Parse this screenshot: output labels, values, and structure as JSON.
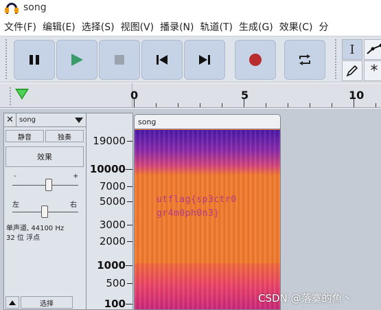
{
  "window": {
    "title": "song"
  },
  "menu": [
    "文件(F)",
    "编辑(E)",
    "选择(S)",
    "视图(V)",
    "播录(N)",
    "轨道(T)",
    "生成(G)",
    "效果(C)",
    "分"
  ],
  "timeline": {
    "labels": [
      "0",
      "5",
      "10"
    ]
  },
  "track": {
    "name": "song",
    "mute_label": "静音",
    "solo_label": "独奏",
    "effects_label": "效果",
    "gain_minus": "-",
    "gain_plus": "+",
    "pan_left": "左",
    "pan_right": "右",
    "info_line1": "单声道, 44100 Hz",
    "info_line2": "32 位 浮点",
    "select_label": "选择",
    "clip_name": "song"
  },
  "scale": {
    "labels": [
      "19000",
      "10000",
      "7000",
      "5000",
      "3000",
      "2000",
      "1000",
      "500",
      "100"
    ]
  },
  "spectrogram": {
    "hidden_text_line1": "utflag{sp3ctr0",
    "hidden_text_line2": "gr4m0ph0n3}"
  },
  "watermark": "CSDN @落寞的魚丶",
  "colors": {
    "spec_high": "#6a22b8",
    "spec_mid": "#f07a2e",
    "spec_low": "#e83e6a",
    "record": "#b82e2e",
    "play": "#3a9a6a"
  }
}
